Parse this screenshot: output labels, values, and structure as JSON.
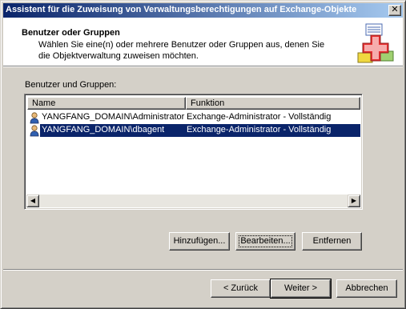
{
  "window": {
    "title": "Assistent für die Zuweisung von Verwaltungsberechtigungen auf Exchange-Objekte",
    "close_glyph": "✕"
  },
  "header": {
    "title": "Benutzer oder Gruppen",
    "description": "Wählen Sie eine(n) oder mehrere Benutzer oder Gruppen aus, denen Sie die Objektverwaltung zuweisen möchten.",
    "icon": "exchange-wizard-icon"
  },
  "group_label": "Benutzer und Gruppen:",
  "list": {
    "columns": [
      "Name",
      "Funktion"
    ],
    "rows": [
      {
        "name": "YANGFANG_DOMAIN\\Administrator",
        "role": "Exchange-Administrator - Vollständig",
        "selected": false,
        "icon": "user-icon"
      },
      {
        "name": "YANGFANG_DOMAIN\\dbagent",
        "role": "Exchange-Administrator - Vollständig",
        "selected": true,
        "icon": "user-icon"
      }
    ],
    "scroll_left_glyph": "◀",
    "scroll_right_glyph": "▶"
  },
  "actions": {
    "add": "Hinzufügen...",
    "edit": "Bearbeiten...",
    "remove": "Entfernen"
  },
  "footer": {
    "back": "< Zurück",
    "next": "Weiter >",
    "cancel": "Abbrechen"
  }
}
